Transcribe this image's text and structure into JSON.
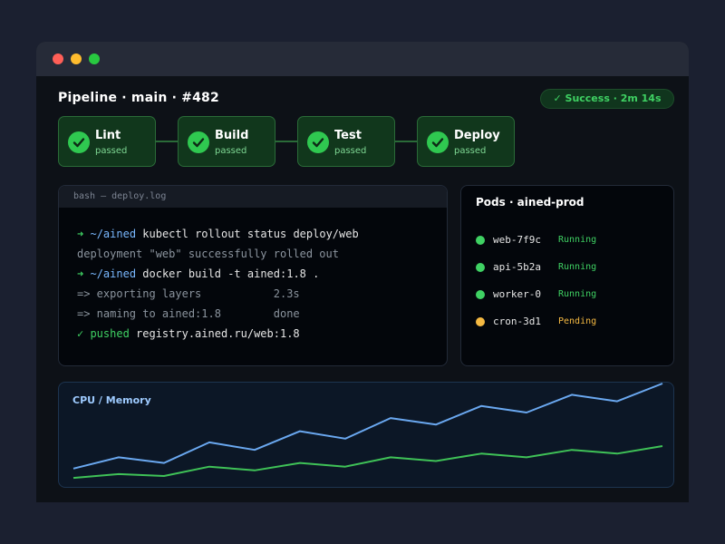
{
  "window": {
    "controls": [
      "close",
      "minimize",
      "maximize"
    ]
  },
  "pipeline": {
    "title": "Pipeline · main · #482",
    "badge": "✓ Success · 2m 14s",
    "stages": [
      {
        "name": "Lint",
        "status": "passed",
        "icon": "check-icon"
      },
      {
        "name": "Build",
        "status": "passed",
        "icon": "check-icon"
      },
      {
        "name": "Test",
        "status": "passed",
        "icon": "check-icon"
      },
      {
        "name": "Deploy",
        "status": "passed",
        "icon": "check-icon"
      }
    ]
  },
  "terminal": {
    "header": "bash — deploy.log",
    "lines": [
      {
        "prompt": "➜",
        "path": "~/ained",
        "cmd": "kubectl rollout status deploy/web"
      },
      {
        "text": "deployment \"web\" successfully rolled out"
      },
      {
        "prompt": "➜",
        "path": "~/ained",
        "cmd": "docker build -t ained:1.8 ."
      },
      {
        "text": "=> exporting layers           2.3s"
      },
      {
        "text": "=> naming to ained:1.8        done"
      },
      {
        "ok": "✓ pushed",
        "rest": "registry.ained.ru/web:1.8"
      }
    ]
  },
  "pods": {
    "title": "Pods · ained-prod",
    "items": [
      {
        "name": "web-7f9c",
        "status": "Running"
      },
      {
        "name": "api-5b2a",
        "status": "Running"
      },
      {
        "name": "worker-0",
        "status": "Running"
      },
      {
        "name": "cron-3d1",
        "status": "Pending"
      }
    ]
  },
  "colors": {
    "running": "#3fd163",
    "pending": "#f5b942",
    "cpu_line": "#6aa8f0",
    "memory_line": "#3fc257",
    "stage_check": "#2fc850"
  },
  "chart": {
    "title": "CPU / Memory",
    "chart_data": {
      "type": "line",
      "grid": false,
      "legend": "none",
      "x": [
        1,
        2,
        3,
        4,
        5,
        6,
        7,
        8,
        9,
        10,
        11,
        12,
        13,
        14
      ],
      "ylim": [
        0,
        100
      ],
      "series": [
        {
          "values": [
            8,
            20,
            14,
            36,
            28,
            48,
            40,
            62,
            55,
            75,
            68,
            87,
            80,
            99
          ]
        },
        {
          "values": [
            -2,
            2,
            0,
            10,
            6,
            14,
            10,
            20,
            16,
            24,
            20,
            28,
            24,
            32
          ]
        }
      ]
    }
  }
}
